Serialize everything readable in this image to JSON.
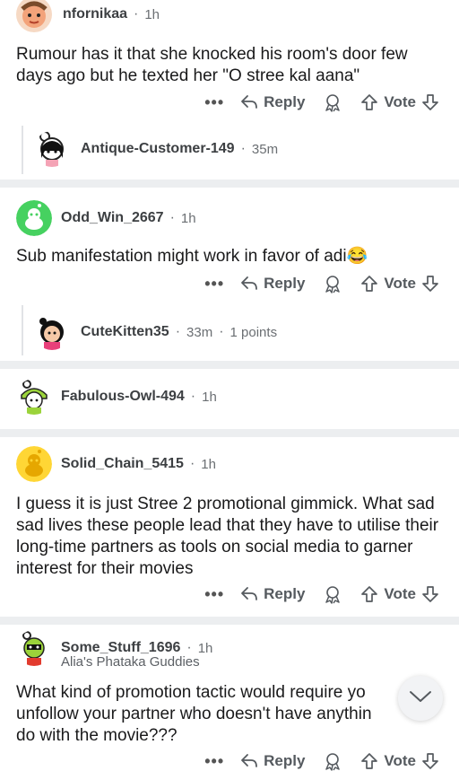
{
  "comments": [
    {
      "author": "nfornikaa",
      "time": "1h",
      "text": "Rumour has it that she knocked his room's door few days ago but he texted her \"O stree kal aana\"",
      "reply_label": "Reply",
      "vote_label": "Vote",
      "more": "•••",
      "child": {
        "author": "Antique-Customer-149",
        "time": "35m"
      }
    },
    {
      "author": "Odd_Win_2667",
      "time": "1h",
      "text": "Sub manifestation might work in favor of adi",
      "emoji": "😂",
      "reply_label": "Reply",
      "vote_label": "Vote",
      "more": "•••",
      "child": {
        "author": "CuteKitten35",
        "time": "33m",
        "points": "1 points"
      }
    },
    {
      "author": "Fabulous-Owl-494",
      "time": "1h"
    },
    {
      "author": "Solid_Chain_5415",
      "time": "1h",
      "text": "I guess it is just Stree 2 promotional gimmick. What sad sad lives these people lead that they have to utilise their long-time partners as tools on social media to garner interest for their movies",
      "reply_label": "Reply",
      "vote_label": "Vote",
      "more": "•••"
    },
    {
      "author": "Some_Stuff_1696",
      "time": "1h",
      "flair": "Alia's Phataka Guddies",
      "text_lines": [
        "What kind of promotion tactic would require yo",
        "unfollow your partner who doesn't have anythin",
        "do with the movie???"
      ],
      "reply_label": "Reply",
      "vote_label": "Vote",
      "more": "•••"
    }
  ],
  "colors": {
    "separator": "#eceef0",
    "username": "#3c3f42",
    "meta": "#6b6f73",
    "action": "#555a5f",
    "odd_win_avatar": "#46d160",
    "solid_chain_avatar": "#ffd635"
  },
  "icons": {
    "reply": "reply-arrow-icon",
    "award": "award-icon",
    "upvote": "upvote-arrow-icon",
    "downvote": "downvote-arrow-icon",
    "scroll_down": "chevron-down-icon"
  }
}
